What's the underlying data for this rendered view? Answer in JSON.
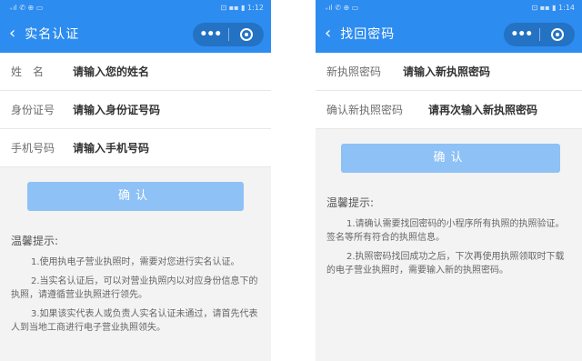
{
  "left": {
    "status": {
      "left": "₊ıl ✆ ⊕ ▭",
      "right": "⊡ ▪▪ ▮ 1:12"
    },
    "nav": {
      "back_icon": "chevron-left-icon",
      "title": "实名认证",
      "more_icon": "more-dots-icon",
      "close_icon": "close-circle-icon"
    },
    "fields": [
      {
        "label": "姓　名",
        "value": "请输入您的姓名"
      },
      {
        "label": "身份证号",
        "value": "请输入身份证号码"
      },
      {
        "label": "手机号码",
        "value": "请输入手机号码"
      }
    ],
    "confirm_label": "确认",
    "tips_title": "温馨提示:",
    "tips": [
      "1.使用执电子营业执照时，需要对您进行实名认证。",
      "2.当实名认证后，可以对营业执照内以对应身份信息下的执照，请遵循营业执照进行领先。",
      "3.如果该实代表人或负责人实名认证未通过，请首先代表人到当地工商进行电子营业执照领失。"
    ]
  },
  "right": {
    "status": {
      "left": "₊ıl ✆ ⊕ ▭",
      "right": "⊡ ▪▪ ▮ 1:14"
    },
    "nav": {
      "back_icon": "chevron-left-icon",
      "title": "找回密码",
      "more_icon": "more-dots-icon",
      "close_icon": "close-circle-icon"
    },
    "fields": [
      {
        "label": "新执照密码",
        "value": "请输入新执照密码"
      },
      {
        "label": "确认新执照密码",
        "value": "请再次输入新执照密码"
      }
    ],
    "confirm_label": "确认",
    "tips_title": "温馨提示:",
    "tips": [
      "1.请确认需要找回密码的小程序所有执照的执照验证。签名等所有符合的执照信息。",
      "2.执照密码找回成功之后，下次再使用执照领取时下载的电子营业执照时，需要输入新的执照密码。"
    ]
  }
}
